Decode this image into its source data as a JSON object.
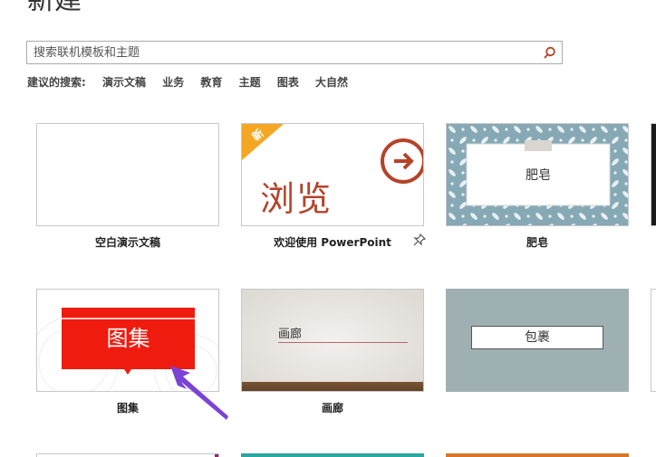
{
  "header": {
    "title": "新建"
  },
  "search": {
    "placeholder": "搜索联机模板和主题",
    "icon": "search-icon"
  },
  "suggestions": {
    "lead": "建议的搜索:",
    "items": [
      "演示文稿",
      "业务",
      "教育",
      "主题",
      "图表",
      "大自然"
    ]
  },
  "templates": [
    {
      "label": "空白演示文稿"
    },
    {
      "label": "欢迎使用 PowerPoint",
      "thumb_text": "浏览",
      "badge": "新",
      "pin": "pin-icon"
    },
    {
      "label": "肥皂",
      "thumb_text": "肥皂"
    },
    {
      "label": "图集",
      "thumb_text": "图集"
    },
    {
      "label": "画廊",
      "thumb_text": "画廊"
    },
    {
      "label": "",
      "thumb_text": "包裹"
    }
  ],
  "colors": {
    "accent_orange": "#f5a623",
    "browse_red": "#b5432a",
    "atlas_red": "#f01b0f",
    "soap_blue": "#86a9b5",
    "package_gray": "#9fb0b3",
    "annotation_arrow": "#7a43d6"
  }
}
